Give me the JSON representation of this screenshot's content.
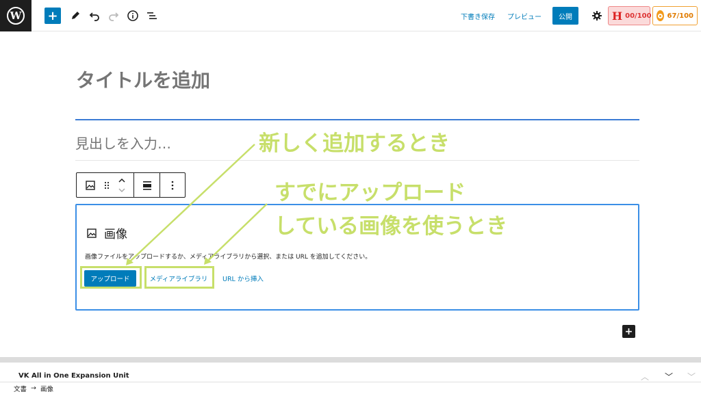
{
  "toolbar": {
    "save_draft": "下書き保存",
    "preview": "プレビュー",
    "publish": "公開",
    "headline_score": "00/100",
    "seo_score": "67/100"
  },
  "editor": {
    "title_placeholder": "タイトルを追加",
    "heading_placeholder": "見出しを入力…"
  },
  "image_block": {
    "title": "画像",
    "description": "画像ファイルをアップロードするか、メディアライブラリから選択、または URL を追加してください。",
    "upload_label": "アップロード",
    "media_library_label": "メディアライブラリ",
    "url_insert_label": "URL から挿入"
  },
  "annotations": {
    "new_add": "新しく追加するとき",
    "already_uploaded_line1": "すでにアップロード",
    "already_uploaded_line2": "している画像を使うとき"
  },
  "meta_box": {
    "title": "VK All in One Expansion Unit"
  },
  "breadcrumbs": {
    "root": "文書",
    "arrow": "→",
    "current": "画像"
  },
  "colors": {
    "accent": "#007cba",
    "highlight": "#c7df6a",
    "selection": "#3a8ee6"
  }
}
